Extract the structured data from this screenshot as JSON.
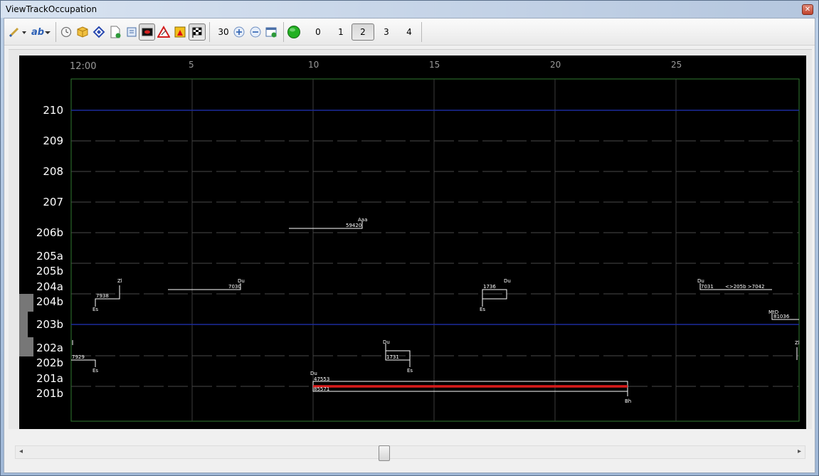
{
  "window": {
    "title": "ViewTrackOccupation",
    "close_glyph": "✕"
  },
  "toolbar": {
    "pen_icon": "pen-icon",
    "ab_label": "ab",
    "zoom_value": "30",
    "zoom_in": "+",
    "zoom_out": "−",
    "levels": [
      "0",
      "1",
      "2",
      "3",
      "4"
    ],
    "selected_level": "2"
  },
  "time_axis": {
    "labels": [
      "12:00",
      "5",
      "10",
      "15",
      "20",
      "25"
    ]
  },
  "tracks": [
    "210",
    "209",
    "208",
    "207",
    "206b",
    "205a",
    "205b",
    "204a",
    "204b",
    "203b",
    "202a",
    "202b",
    "201a",
    "201b"
  ],
  "occupations": [
    {
      "top": "Aaa",
      "bottom": "59420"
    },
    {
      "top": "Du",
      "bottom": "7030"
    },
    {
      "top": "Zl",
      "bottom": "7938",
      "below": "Es"
    },
    {
      "top": "Du",
      "bottom": "1736",
      "below": "Es"
    },
    {
      "top": "Du",
      "bottom": "7031",
      "extra": "<>205b >7042"
    },
    {
      "top": "MtD",
      "bottom": "81036"
    },
    {
      "top": "Du",
      "bottom": "1731",
      "below": "Es"
    },
    {
      "top": "l",
      "bottom": "7929",
      "below": "Es"
    },
    {
      "top": "Zl",
      "bottom": ""
    },
    {
      "top": "Du",
      "bottom": "47553",
      "bottom2": "85571",
      "below": "Bh"
    }
  ],
  "colors": {
    "chart_bg": "#000000",
    "axis_frame": "#2f7a2f",
    "highlight_track": "#1c2a9c",
    "grid": "#444444",
    "label": "#ffffff",
    "occupied": "#d81b1b",
    "status_green": "#22b022"
  }
}
